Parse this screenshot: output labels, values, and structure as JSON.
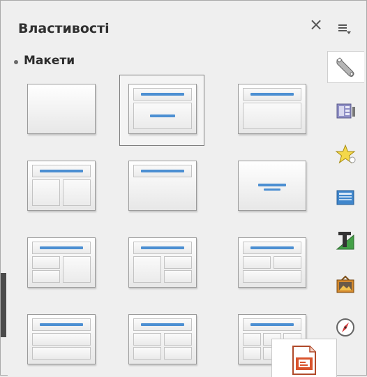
{
  "panel": {
    "title": "Властивості"
  },
  "section": {
    "title": "Макети",
    "expanded": true
  },
  "layouts": [
    {
      "name": "blank",
      "selected": false
    },
    {
      "name": "title-content",
      "selected": true
    },
    {
      "name": "title-content-box",
      "selected": false
    },
    {
      "name": "title-two-columns",
      "selected": false
    },
    {
      "name": "title-only",
      "selected": false
    },
    {
      "name": "centered-text",
      "selected": false
    },
    {
      "name": "title-2-content-and-content",
      "selected": false
    },
    {
      "name": "title-content-and-2-content",
      "selected": false
    },
    {
      "name": "title-2-content-over-content",
      "selected": false
    },
    {
      "name": "title-content-over-content",
      "selected": false
    },
    {
      "name": "title-4-content",
      "selected": false
    },
    {
      "name": "title-6-content",
      "selected": false
    }
  ],
  "sidebar_tabs": [
    {
      "icon": "properties-wrench-icon",
      "active": true
    },
    {
      "icon": "slide-transition-icon",
      "active": false
    },
    {
      "icon": "animation-star-icon",
      "active": false
    },
    {
      "icon": "master-slides-icon",
      "active": false
    },
    {
      "icon": "styles-icon",
      "active": false
    },
    {
      "icon": "gallery-icon",
      "active": false
    },
    {
      "icon": "navigator-compass-icon",
      "active": false
    }
  ],
  "colors": {
    "accent": "#4c8fd2",
    "background": "#efefef"
  },
  "tooltip": {
    "icon": "impress-presentation-icon"
  }
}
